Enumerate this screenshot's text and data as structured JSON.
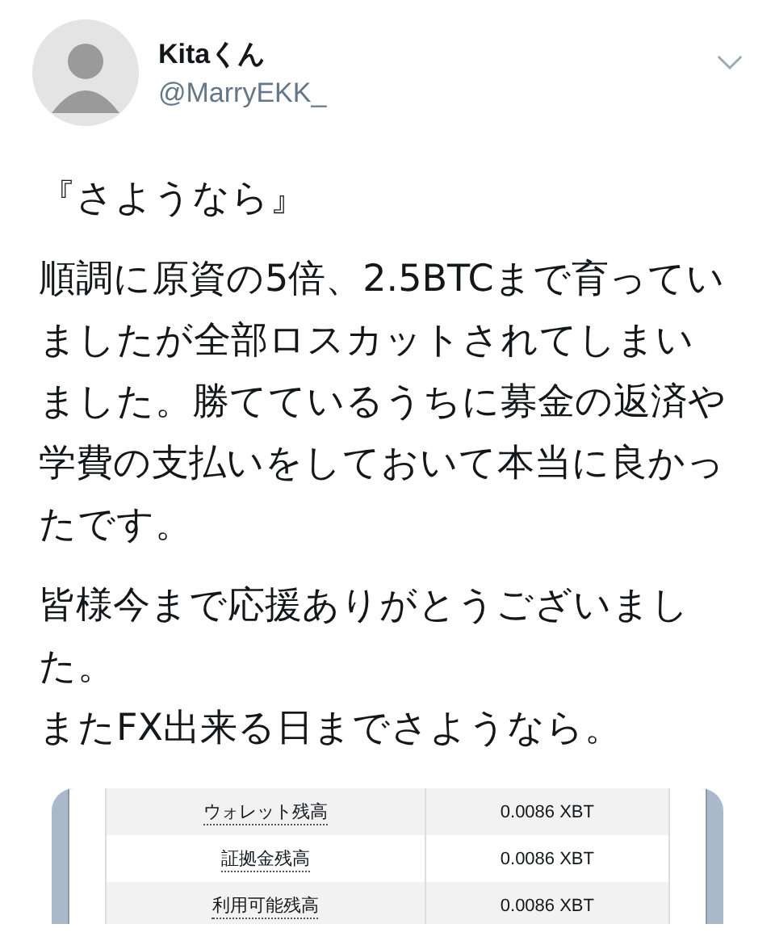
{
  "author": {
    "name": "Kitaくん",
    "handle": "@MarryEKK_"
  },
  "paragraphs": [
    [
      "『さようなら』"
    ],
    [
      "順調に原資の5倍、2.5BTCまで育っていましたが全部ロスカットされてしまいました。勝てているうちに募金の返済や学費の支払いをしておいて本当に良かったです。"
    ],
    [
      "皆様今まで応援ありがとうございました。",
      "またFX出来る日までさようなら。"
    ]
  ],
  "attachment": {
    "rows": [
      {
        "label": "ウォレット残高",
        "value": "0.0086 XBT"
      },
      {
        "label": "証拠金残高",
        "value": "0.0086 XBT"
      },
      {
        "label": "利用可能残高",
        "value": "0.0086 XBT"
      }
    ]
  }
}
